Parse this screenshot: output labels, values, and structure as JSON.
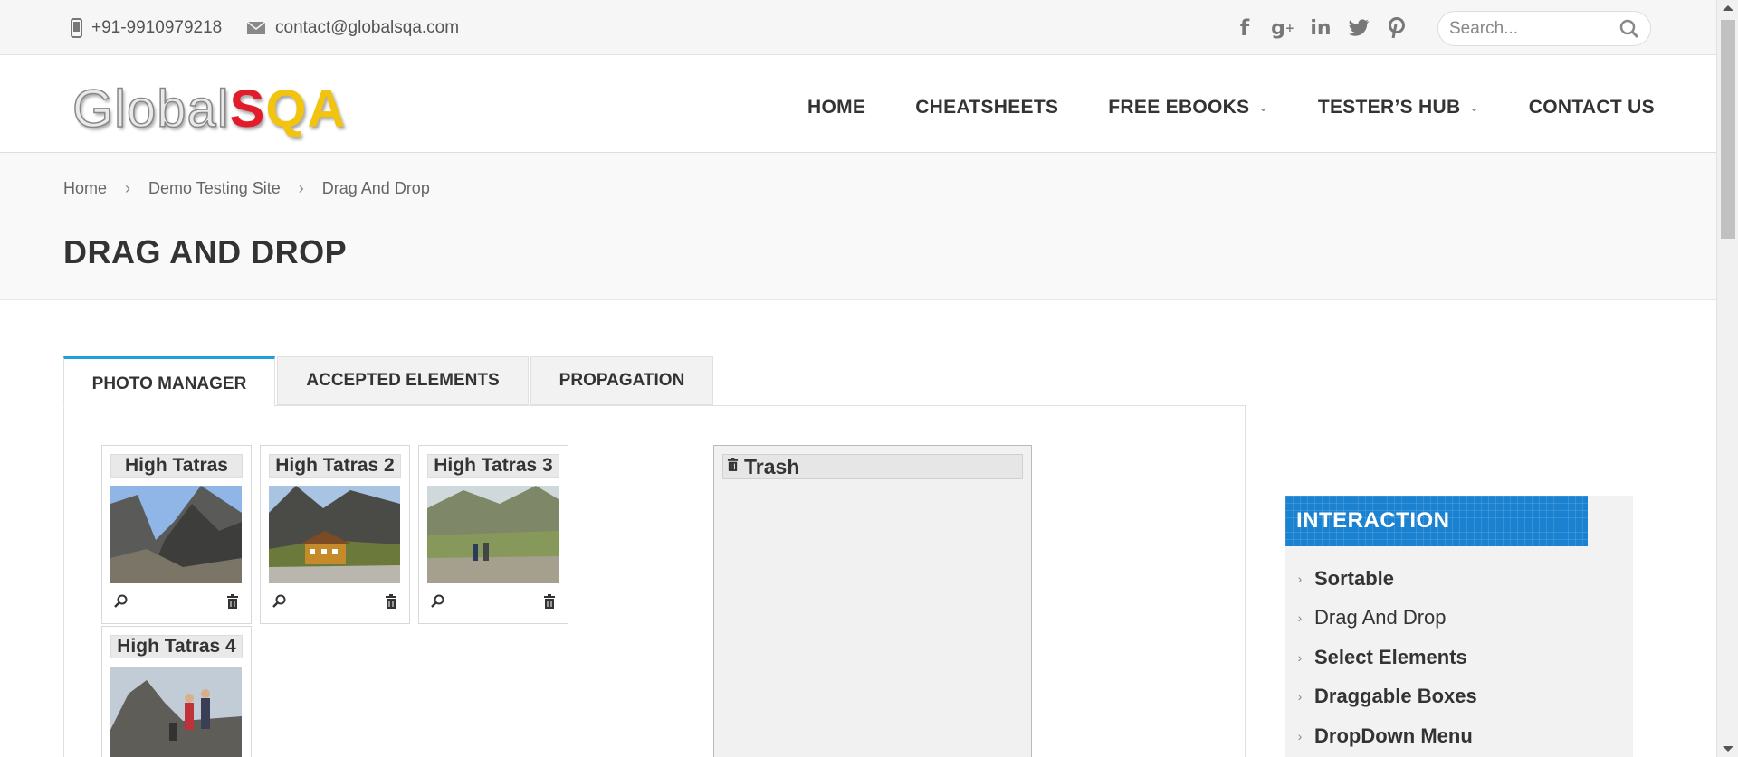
{
  "topbar": {
    "phone": "+91-9910979218",
    "email": "contact@globalsqa.com",
    "social": [
      "facebook-icon",
      "google-plus-icon",
      "linkedin-icon",
      "twitter-icon",
      "pinterest-icon"
    ],
    "search_placeholder": "Search..."
  },
  "logo": {
    "part1": "Global",
    "part2": "S",
    "part3": "QA"
  },
  "nav": {
    "home": "HOME",
    "cheatsheets": "CHEATSHEETS",
    "free_ebooks": "FREE EBOOKS",
    "testers_hub": "TESTER’S HUB",
    "contact_us": "CONTACT US"
  },
  "breadcrumb": [
    "Home",
    "Demo Testing Site",
    "Drag And Drop"
  ],
  "page_title": "DRAG AND DROP",
  "tabs": [
    "PHOTO MANAGER",
    "ACCEPTED ELEMENTS",
    "PROPAGATION"
  ],
  "gallery": [
    {
      "title": "High Tatras"
    },
    {
      "title": "High Tatras 2"
    },
    {
      "title": "High Tatras 3"
    },
    {
      "title": "High Tatras 4"
    }
  ],
  "trash": {
    "title": "Trash"
  },
  "sidebar": {
    "heading": "INTERACTION",
    "items": [
      "Sortable",
      "Drag And Drop",
      "Select Elements",
      "Draggable Boxes",
      "DropDown Menu"
    ]
  },
  "colors": {
    "accent": "#1ea1d9",
    "sidebar_head": "#1a82d1",
    "logo_red": "#e21c2a",
    "logo_yellow": "#f2c30f"
  }
}
